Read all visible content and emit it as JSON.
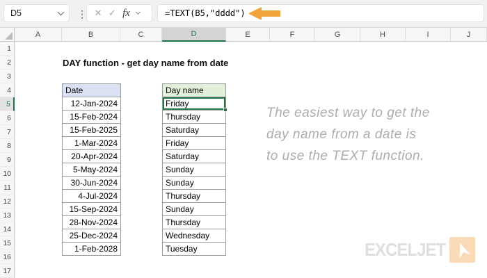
{
  "formula_bar": {
    "name_box_value": "D5",
    "formula": "=TEXT(B5,\"dddd\")",
    "icons": {
      "separator_dots": "⋮",
      "cancel": "✕",
      "enter": "✓",
      "insert_function": "fx"
    }
  },
  "grid": {
    "column_letters": [
      "A",
      "B",
      "C",
      "D",
      "E",
      "F",
      "G",
      "H",
      "I",
      "J"
    ],
    "row_numbers": [
      "1",
      "2",
      "3",
      "4",
      "5",
      "6",
      "7",
      "8",
      "9",
      "10",
      "11",
      "12",
      "13",
      "14",
      "15",
      "16",
      "17"
    ],
    "selected_cell": "D5",
    "selected_column": "D",
    "selected_row": "5"
  },
  "sheet": {
    "title": "DAY function - get day name from date",
    "table": {
      "date_header": "Date",
      "day_header": "Day name",
      "rows": [
        {
          "date": "12-Jan-2024",
          "day": "Friday"
        },
        {
          "date": "15-Feb-2024",
          "day": "Thursday"
        },
        {
          "date": "15-Feb-2025",
          "day": "Saturday"
        },
        {
          "date": "1-Mar-2024",
          "day": "Friday"
        },
        {
          "date": "20-Apr-2024",
          "day": "Saturday"
        },
        {
          "date": "5-May-2024",
          "day": "Sunday"
        },
        {
          "date": "30-Jun-2024",
          "day": "Sunday"
        },
        {
          "date": "4-Jul-2024",
          "day": "Thursday"
        },
        {
          "date": "15-Sep-2024",
          "day": "Sunday"
        },
        {
          "date": "28-Nov-2024",
          "day": "Thursday"
        },
        {
          "date": "25-Dec-2024",
          "day": "Wednesday"
        },
        {
          "date": "1-Feb-2028",
          "day": "Tuesday"
        }
      ]
    },
    "annotation": {
      "lines": [
        "The easiest way to get the",
        "day name from a date is",
        "to use the TEXT function."
      ]
    },
    "logo": {
      "text": "EXCELJET"
    }
  },
  "colors": {
    "accent_green": "#217346",
    "arrow_orange": "#F0A43A",
    "date_header_fill": "#D9E1F2",
    "day_header_fill": "#E2EFDA",
    "annotation_gray": "#ACACAC",
    "logo_gray": "#DFDFDF",
    "logo_orange": "#FBDBB7"
  }
}
